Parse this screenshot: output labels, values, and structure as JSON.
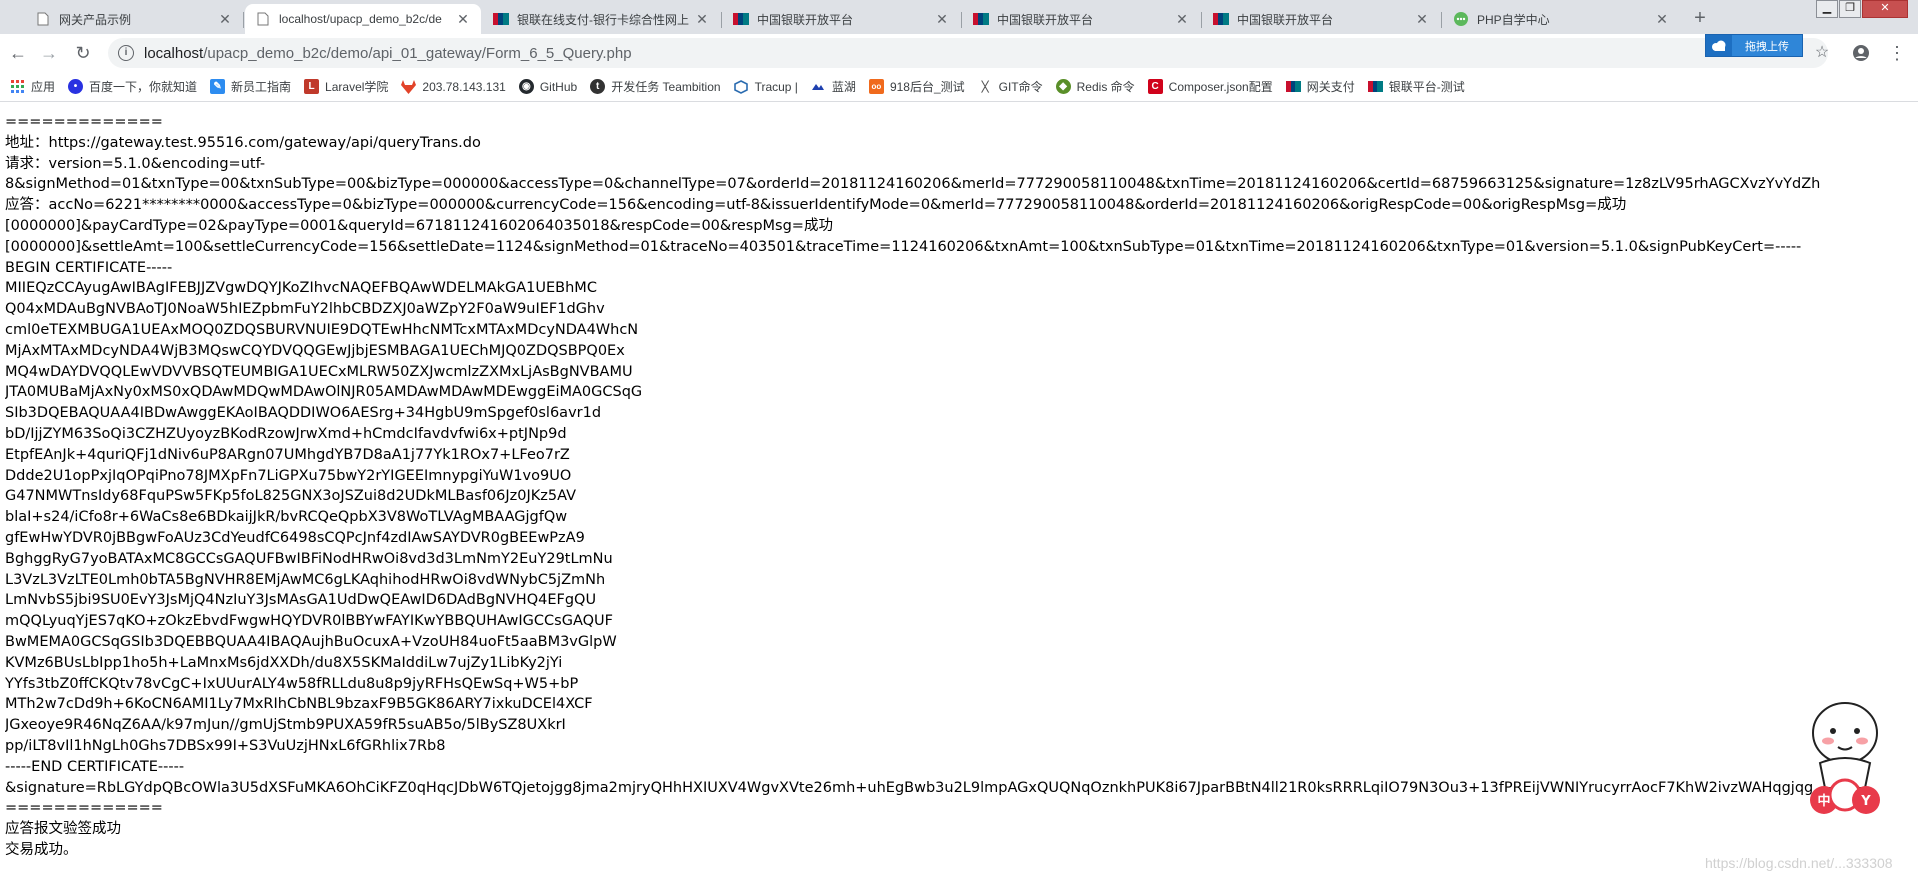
{
  "tabs": [
    {
      "title": "网关产品示例",
      "active": false
    },
    {
      "title": "localhost/upacp_demo_b2c/de",
      "active": true
    },
    {
      "title": "银联在线支付-银行卡综合性网上",
      "active": false
    },
    {
      "title": "中国银联开放平台",
      "active": false
    },
    {
      "title": "中国银联开放平台",
      "active": false
    },
    {
      "title": "中国银联开放平台",
      "active": false
    },
    {
      "title": "PHP自学中心",
      "active": false
    }
  ],
  "address": {
    "host": "localhost",
    "path": "/upacp_demo_b2c/demo/api_01_gateway/Form_6_5_Query.php"
  },
  "upload_button": "拖拽上传",
  "bookmarks": [
    {
      "label": "应用",
      "icon": "apps-grid-icon",
      "color": "#1a73e8"
    },
    {
      "label": "百度一下，你就知道",
      "icon": "baidu-paw-icon",
      "color": "#2932e1"
    },
    {
      "label": "新员工指南",
      "icon": "doc-icon",
      "color": "#2d8cf0"
    },
    {
      "label": "Laravel学院",
      "icon": "laravel-icon",
      "color": "#c0392b"
    },
    {
      "label": "203.78.143.131",
      "icon": "gitlab-icon",
      "color": "#e24329"
    },
    {
      "label": "GitHub",
      "icon": "github-icon",
      "color": "#24292e"
    },
    {
      "label": "开发任务 Teambition",
      "icon": "teambition-icon",
      "color": "#333333"
    },
    {
      "label": "Tracup |",
      "icon": "tracup-icon",
      "color": "#2b6cb0"
    },
    {
      "label": "蓝湖",
      "icon": "lanhu-icon",
      "color": "#1e40af"
    },
    {
      "label": "918后台_测试",
      "icon": "918-icon",
      "color": "#f06a1d"
    },
    {
      "label": "GIT命令",
      "icon": "git-icon",
      "color": "#555555"
    },
    {
      "label": "Redis 命令",
      "icon": "redis-icon",
      "color": "#5a8f29"
    },
    {
      "label": "Composer.json配置",
      "icon": "composer-icon",
      "color": "#d0021b"
    },
    {
      "label": "网关支付",
      "icon": "unionpay-icon",
      "color": "#c8102e"
    },
    {
      "label": "银联平台-测试",
      "icon": "unionpay-icon",
      "color": "#c8102e"
    }
  ],
  "lines": [
    "=============",
    "地址：https://gateway.test.95516.com/gateway/api/queryTrans.do",
    "请求：version=5.1.0&encoding=utf-",
    "8&signMethod=01&txnType=00&txnSubType=00&bizType=000000&accessType=0&channelType=07&orderId=20181124160206&merId=777290058110048&txnTime=20181124160206&certId=68759663125&signature=1z8zLV95rhAGCXvzYvYdZh",
    "应答：accNo=6221********0000&accessType=0&bizType=000000&currencyCode=156&encoding=utf-8&issuerIdentifyMode=0&merId=777290058110048&orderId=20181124160206&origRespCode=00&origRespMsg=成功",
    "[0000000]&payCardType=02&payType=0001&queryId=671811241602064035018&respCode=00&respMsg=成功",
    "[0000000]&settleAmt=100&settleCurrencyCode=156&settleDate=1124&signMethod=01&traceNo=403501&traceTime=1124160206&txnAmt=100&txnSubType=01&txnTime=20181124160206&txnType=01&version=5.1.0&signPubKeyCert=-----",
    "BEGIN CERTIFICATE-----",
    "MIIEQzCCAyugAwIBAgIFEBJJZVgwDQYJKoZIhvcNAQEFBQAwWDELMAkGA1UEBhMC",
    "Q04xMDAuBgNVBAoTJ0NoaW5hIEZpbmFuY2lhbCBDZXJ0aWZpY2F0aW9uIEF1dGhv",
    "cml0eTEXMBUGA1UEAxMOQ0ZDQSBURVNUIE9DQTEwHhcNMTcxMTAxMDcyNDA4WhcN",
    "MjAxMTAxMDcyNDA4WjB3MQswCQYDVQQGEwJjbjESMBAGA1UEChMJQ0ZDQSBPQ0Ex",
    "MQ4wDAYDVQQLEwVDVVBSQTEUMBIGA1UECxMLRW50ZXJwcmlzZXMxLjAsBgNVBAMU",
    "JTA0MUBaMjAxNy0xMS0xQDAwMDQwMDAwOlNJR05AMDAwMDAwMDEwggEiMA0GCSqG",
    "SIb3DQEBAQUAA4IBDwAwggEKAoIBAQDDIWO6AESrg+34HgbU9mSpgef0sl6avr1d",
    "bD/IjjZYM63SoQi3CZHZUyoyzBKodRzowJrwXmd+hCmdcIfavdvfwi6x+ptJNp9d",
    "EtpfEAnJk+4quriQFj1dNiv6uP8ARgn07UMhgdYB7D8aA1j77Yk1ROx7+LFeo7rZ",
    "Ddde2U1opPxjIqOPqiPno78JMXpFn7LiGPXu75bwY2rYIGEEImnypgiYuW1vo9UO",
    "G47NMWTnsIdy68FquPSw5FKp5foL825GNX3oJSZui8d2UDkMLBasf06Jz0JKz5AV",
    "blaI+s24/iCfo8r+6WaCs8e6BDkaijJkR/bvRCQeQpbX3V8WoTLVAgMBAAGjgfQw",
    "gfEwHwYDVR0jBBgwFoAUz3CdYeudfC6498sCQPcJnf4zdIAwSAYDVR0gBEEwPzA9",
    "BghggRyG7yoBATAxMC8GCCsGAQUFBwIBFiNodHRwOi8vd3d3LmNmY2EuY29tLmNu",
    "L3VzL3VzLTE0Lmh0bTA5BgNVHR8EMjAwMC6gLKAqhihodHRwOi8vdWNybC5jZmNh",
    "LmNvbS5jbi9SU0EvY3JsMjQ4NzIuY3JsMAsGA1UdDwQEAwID6DAdBgNVHQ4EFgQU",
    "mQQLyuqYjES7qKO+zOkzEbvdFwgwHQYDVR0lBBYwFAYIKwYBBQUHAwIGCCsGAQUF",
    "BwMEMA0GCSqGSIb3DQEBBQUAA4IBAQAujhBuOcuxA+VzoUH84uoFt5aaBM3vGlpW",
    "KVMz6BUsLbIpp1ho5h+LaMnxMs6jdXXDh/du8X5SKMaIddiLw7ujZy1LibKy2jYi",
    "YYfs3tbZ0ffCKQtv78vCgC+IxUUurALY4w58fRLLdu8u8p9jyRFHsQEwSq+W5+bP",
    "MTh2w7cDd9h+6KoCN6AMI1Ly7MxRIhCbNBL9bzaxF9B5GK86ARY7ixkuDCEl4XCF",
    "JGxeoye9R46NqZ6AA/k97mJun//gmUjStmb9PUXA59fR5suAB5o/5lBySZ8UXkrI",
    "pp/iLT8vIl1hNgLh0Ghs7DBSx99I+S3VuUzjHNxL6fGRhlix7Rb8",
    "-----END CERTIFICATE-----",
    "&signature=RbLGYdpQBcOWla3U5dXSFuMKA6OhCiKFZ0qHqcJDbW6TQjetojgg8jma2mjryQHhHXIUXV4WgvXVte26mh+uhEgBwb3u2L9lmpAGxQUQNqOznkhPUK8i67JparBBtN4ll21R0ksRRRLqiIO79N3Ou3+13fPREijVWNIYrucyrrAocF7KhW2ivzWAHqgjqg",
    "=============",
    "应答报文验签成功",
    "交易成功。"
  ],
  "watermark": "https://blog.csdn.net/...333308"
}
